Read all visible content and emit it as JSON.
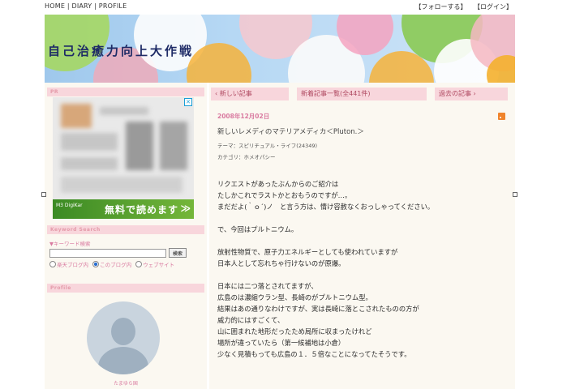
{
  "topnav": {
    "items": [
      "HOME",
      "DIARY",
      "PROFILE"
    ],
    "separator": " | "
  },
  "toplinks": {
    "follow": "【フォローする】",
    "login": "【ログイン】"
  },
  "banner": {
    "title": "自己治癒力向上大作戦"
  },
  "sidebar": {
    "pr_heading": "PR",
    "ad": {
      "cta": "無料で読めます",
      "arrow": "≫",
      "logo": "M3 DigiKar"
    },
    "search_heading": "Keyword Search",
    "search_label": "▼キーワード検索",
    "search_placeholder": "",
    "search_button": "検索",
    "search_scopes": [
      "楽天ブログ内",
      "このブログ内",
      "ウェブサイト"
    ],
    "search_scope_selected": 1,
    "profile_heading": "Profile",
    "profile_name": "たまゆら国"
  },
  "main": {
    "nav": {
      "newer": "‹ 新しい記事",
      "list": "新着記事一覧(全441件)",
      "older": "過去の記事 ›"
    },
    "entry": {
      "date": "2008年12月02日",
      "title": "新しいレメディのマテリアメディカ＜Pluton.＞",
      "theme": "テーマ：スピリチュアル・ライフ(24349)",
      "category": "カテゴリ：ホメオパシー",
      "paragraphs": [
        [
          "リクエストがあったぶんからのご紹介は",
          "たしかこれでラストかとおもうのですが…。",
          "まだだよ(｀ｏ´)ノ　と言う方は、情け容赦なくおっしゃってください。"
        ],
        [
          "で、今回はプルトニウム。"
        ],
        [
          "放射性物質で、原子力エネルギーとしても使われていますが",
          "日本人として忘れちゃ行けないのが原爆。"
        ],
        [
          "日本には二つ落とされてますが、",
          "広島のは濃縮ウラン型、長崎のがプルトニウム型。",
          "結果はあの通りなわけですが、実は長崎に落とこされたものの方が",
          "威力的にはすごくて、",
          "山に囲まれた地形だったため局所に収まったけれど",
          "場所が違っていたら（第一候補地は小倉）",
          "少なく見積もっても広島の１．５倍なことになってたそうです。"
        ]
      ]
    }
  },
  "colors": {
    "accent_pink": "#f8d6dc",
    "pink_text": "#d97aa0",
    "banner_title": "#1e2b66",
    "ad_green": "#3b8a24",
    "rss_orange": "#f0842c"
  },
  "icons": [
    "rss-icon",
    "close-icon",
    "radio-icon",
    "avatar-silhouette"
  ]
}
